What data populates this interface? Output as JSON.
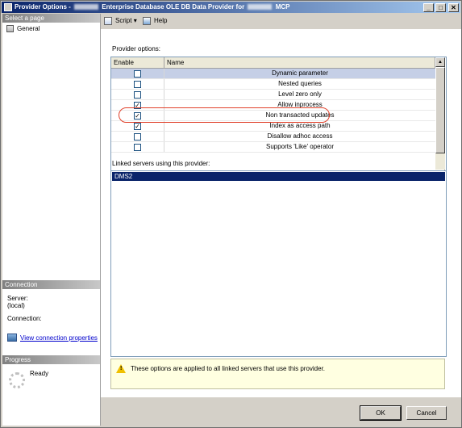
{
  "window": {
    "title_prefix": "Provider Options -",
    "title_middle": "Enterprise Database OLE DB Data Provider for",
    "title_suffix": "MCP",
    "controls": [
      "_",
      "□",
      "✕"
    ]
  },
  "left_pane": {
    "select_page_header": "Select a page",
    "pages": [
      {
        "label": "General",
        "icon": "page-icon"
      }
    ],
    "connection_header": "Connection",
    "server_label": "Server:",
    "server_value": "(local)",
    "connection_label": "Connection:",
    "view_connection_link": "View connection properties",
    "progress_header": "Progress",
    "progress_status": "Ready"
  },
  "toolbar": {
    "script_label": "Script",
    "help_label": "Help"
  },
  "provider_options": {
    "label": "Provider options:",
    "columns": [
      "Enable",
      "Name"
    ],
    "rows": [
      {
        "name": "Dynamic parameter",
        "checked": false,
        "selected": true
      },
      {
        "name": "Nested queries",
        "checked": false
      },
      {
        "name": "Level zero only",
        "checked": false
      },
      {
        "name": "Allow inprocess",
        "checked": true
      },
      {
        "name": "Non transacted updates",
        "checked": true
      },
      {
        "name": "Index as access path",
        "checked": true
      },
      {
        "name": "Disallow adhoc access",
        "checked": false
      },
      {
        "name": "Supports 'Like' operator",
        "checked": false
      }
    ]
  },
  "linked_servers": {
    "label": "Linked servers using this provider:",
    "items": [
      "DMS2"
    ]
  },
  "info": {
    "text": "These options are applied to all linked servers that use this provider."
  },
  "buttons": {
    "ok": "OK",
    "cancel": "Cancel"
  },
  "colors": {
    "title_bar": "#0a246a",
    "selection": "#0a246a",
    "highlight_ring": "#e0402a",
    "info_background": "#ffffe1"
  }
}
